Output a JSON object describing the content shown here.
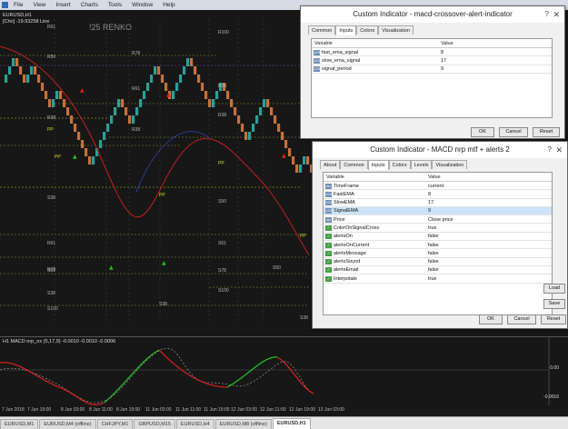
{
  "menu": [
    "File",
    "View",
    "Insert",
    "Charts",
    "Tools",
    "Window",
    "Help"
  ],
  "chart": {
    "symbol_line": "EURUSD,H1",
    "info_line": "[Chn] -19.93258 Line",
    "renko_label": "!25 RENKO",
    "level_labels": [
      "R61",
      "R50",
      "R78",
      "R61",
      "R38",
      "R38",
      "R100",
      "R50",
      "R38",
      "R61",
      "R78",
      "PP",
      "PP",
      "PP",
      "PP",
      "PP",
      "S38",
      "S50",
      "S61",
      "S78",
      "S100",
      "S38",
      "S61",
      "S38",
      "S50",
      "S100",
      "S38"
    ]
  },
  "indicator_pane": {
    "header": "H1 MACD nrp_ox (5,17,9) -0.0010 -0.0010 -0.0006",
    "scale_mid": "0.00",
    "scale_low": "-0.0016"
  },
  "time_axis": [
    "7 Jun 2018",
    "7 Jun 19:00",
    "8 Jun 03:00",
    "8 Jun 11:00",
    "8 Jun 19:00",
    "11 Jun 03:00",
    "11 Jun 11:00",
    "11 Jun 19:00",
    "12 Jun 03:00",
    "12 Jun 11:00",
    "12 Jun 19:00",
    "13 Jun 03:00"
  ],
  "tabs": [
    "EURUSD,M1",
    "EURUSD,M4 (offline)",
    "CHFJPY,M1",
    "GBPUSD,M15",
    "EURUSD,H4",
    "EURUSD,M8 (offline)",
    "EURUSD,H1"
  ],
  "active_tab": 6,
  "dialog1": {
    "title": "Custom Indicator - macd-crossover-alert-indicator",
    "tabs": [
      "Common",
      "Inputs",
      "Colors",
      "Visualization"
    ],
    "active_tab": 1,
    "col_variable": "Variable",
    "col_value": "Value",
    "rows": [
      {
        "icon": "123",
        "name": "fast_ema_signal",
        "value": "8"
      },
      {
        "icon": "123",
        "name": "slow_ema_signal",
        "value": "17"
      },
      {
        "icon": "123",
        "name": "signal_period",
        "value": "9"
      }
    ],
    "ok": "OK",
    "cancel": "Cancel",
    "reset": "Reset"
  },
  "dialog2": {
    "title": "Custom Indicator - MACD nrp mtf + alerts 2",
    "tabs": [
      "About",
      "Common",
      "Inputs",
      "Colors",
      "Levels",
      "Visualization"
    ],
    "active_tab": 2,
    "col_variable": "Variable",
    "col_value": "Value",
    "rows": [
      {
        "icon": "ab",
        "name": "TimeFrame",
        "value": "current"
      },
      {
        "icon": "123",
        "name": "FastEMA",
        "value": "8"
      },
      {
        "icon": "123",
        "name": "SlowEMA",
        "value": "17"
      },
      {
        "icon": "123",
        "name": "SignalEMA",
        "value": "9"
      },
      {
        "icon": "ab",
        "name": "Price",
        "value": "Close price"
      },
      {
        "icon": "✓",
        "name": "ColorOnSignalCross",
        "value": "true"
      },
      {
        "icon": "✓",
        "name": "alertsOn",
        "value": "false"
      },
      {
        "icon": "✓",
        "name": "alertsOnCurrent",
        "value": "false"
      },
      {
        "icon": "✓",
        "name": "alertsMessage",
        "value": "false"
      },
      {
        "icon": "✓",
        "name": "alertsSound",
        "value": "false"
      },
      {
        "icon": "✓",
        "name": "alertsEmail",
        "value": "false"
      },
      {
        "icon": "✓",
        "name": "Interpolate",
        "value": "true"
      }
    ],
    "load": "Load",
    "save": "Save",
    "ok": "OK",
    "cancel": "Cancel",
    "reset": "Reset"
  },
  "colors": {
    "bull": "#2aa198",
    "bear": "#c9703a",
    "ma": "#c02020",
    "macd_up": "#22c022",
    "macd_down": "#e02020"
  }
}
